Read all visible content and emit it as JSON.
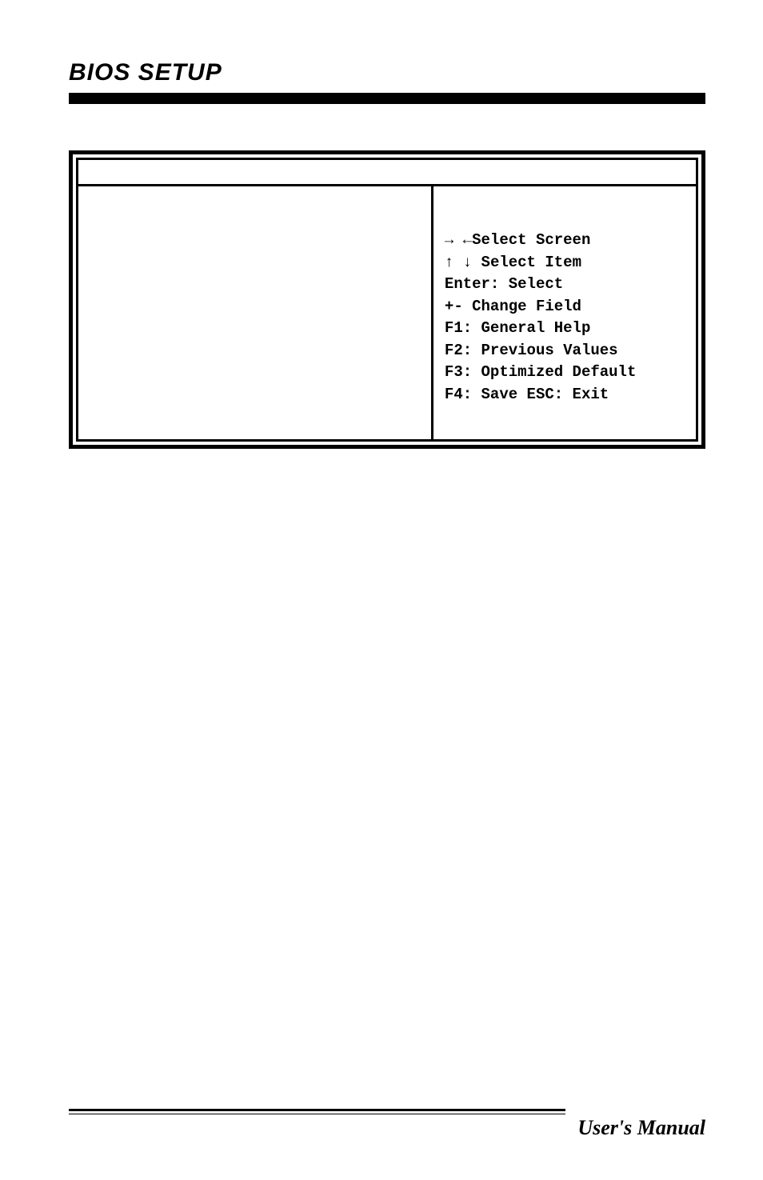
{
  "header": {
    "title": "BIOS SETUP"
  },
  "bios": {
    "help": {
      "select_screen_arrows": "→ ←",
      "select_screen_label": "Select Screen",
      "select_item_arrows": "↑ ↓",
      "select_item_label": "Select Item",
      "enter": "Enter: Select",
      "change_field": "+-  Change Field",
      "f1": "F1: General Help",
      "f2": "F2: Previous Values",
      "f3": "F3: Optimized Default",
      "f4": "F4: Save  ESC: Exit"
    }
  },
  "footer": {
    "text": "User's Manual"
  }
}
